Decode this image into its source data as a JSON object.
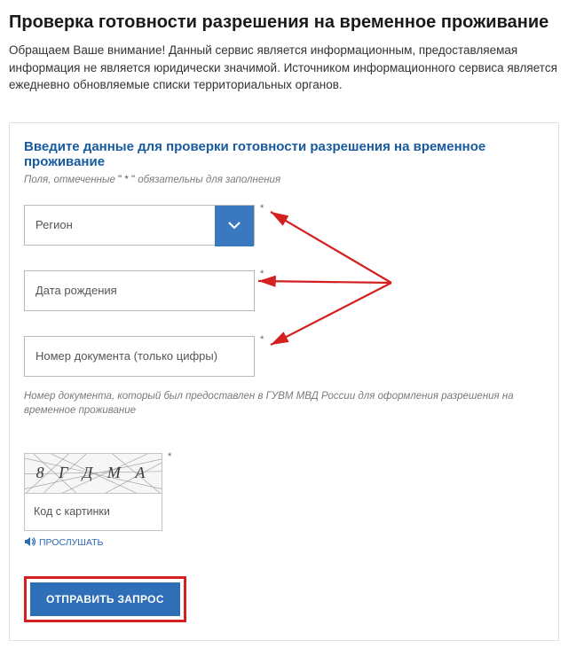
{
  "page": {
    "title": "Проверка готовности разрешения на временное проживание",
    "notice": "Обращаем Ваше внимание! Данный сервис является информационным, предоставляемая информация не является юридически значимой. Источником информационного сервиса является ежедневно обновляемые списки территориальных органов."
  },
  "form": {
    "heading": "Введите данные для проверки готовности разрешения на временное проживание",
    "required_note_prefix": "Поля, отмеченные ",
    "required_note_star": "\" * \"",
    "required_note_suffix": " обязательны для заполнения",
    "region": {
      "placeholder": "Регион"
    },
    "birthdate": {
      "placeholder": "Дата рождения"
    },
    "docnum": {
      "placeholder": "Номер документа (только цифры)",
      "hint": "Номер документа, который был предоставлен в ГУВМ МВД России для оформления разрешения на временное проживание"
    },
    "captcha": {
      "image_text": "8 Г Д М А",
      "input_placeholder": "Код с картинки",
      "listen_label": "ПРОСЛУШАТЬ"
    },
    "submit_label": "ОТПРАВИТЬ ЗАПРОС"
  },
  "colors": {
    "accent": "#2e6fb8",
    "heading_link": "#175a9e",
    "annotation": "#d32020"
  }
}
